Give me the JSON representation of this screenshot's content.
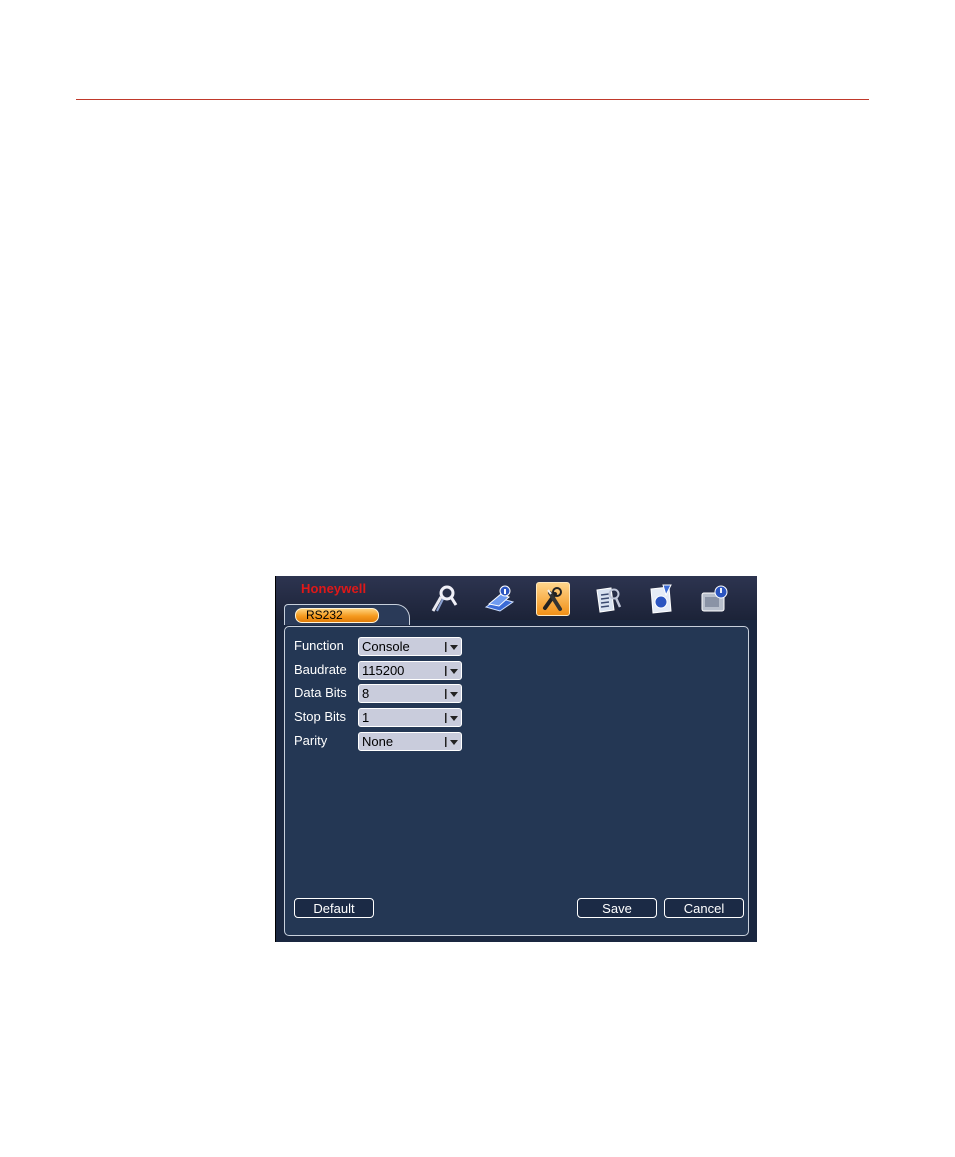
{
  "app": {
    "brand": "Honeywell",
    "tab_label": "RS232"
  },
  "toolbar_icons": [
    {
      "name": "search-icon",
      "active": false
    },
    {
      "name": "info-icon",
      "active": false
    },
    {
      "name": "setting-tools-icon",
      "active": true
    },
    {
      "name": "advanced-icon",
      "active": false
    },
    {
      "name": "backup-icon",
      "active": false
    },
    {
      "name": "shutdown-icon",
      "active": false
    }
  ],
  "form": {
    "function": {
      "label": "Function",
      "value": "Console"
    },
    "baudrate": {
      "label": "Baudrate",
      "value": "115200"
    },
    "data_bits": {
      "label": "Data Bits",
      "value": "8"
    },
    "stop_bits": {
      "label": "Stop Bits",
      "value": "1"
    },
    "parity": {
      "label": "Parity",
      "value": "None"
    }
  },
  "buttons": {
    "default": "Default",
    "save": "Save",
    "cancel": "Cancel"
  },
  "colors": {
    "brand": "#e01818",
    "accent": "#f59a1e",
    "panel": "#243754",
    "page_rule": "#c0392b"
  }
}
